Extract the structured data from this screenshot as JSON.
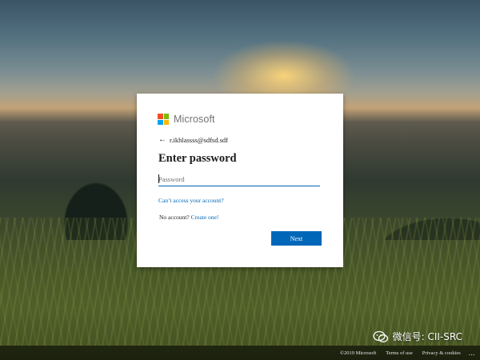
{
  "brand": {
    "name": "Microsoft",
    "colors": [
      "#f25022",
      "#7fba00",
      "#00a4ef",
      "#ffb900"
    ]
  },
  "signin": {
    "identity": "r.ikhlassss@sdfsd.sdf",
    "title": "Enter password",
    "password_placeholder": "Password",
    "cant_access_link": "Can’t access your account?",
    "no_account_prefix": "No account?",
    "create_link": "Create one!",
    "next_button": "Next"
  },
  "footer": {
    "copyright": "©2019 Microsoft",
    "terms": "Terms of use",
    "privacy": "Privacy & cookies",
    "more": "..."
  },
  "watermark": {
    "text": "微信号: CII-SRC",
    "icon": "wechat-icon"
  },
  "colors": {
    "accent": "#0067b8",
    "card_bg": "#ffffff",
    "text": "#1b1b1b"
  }
}
